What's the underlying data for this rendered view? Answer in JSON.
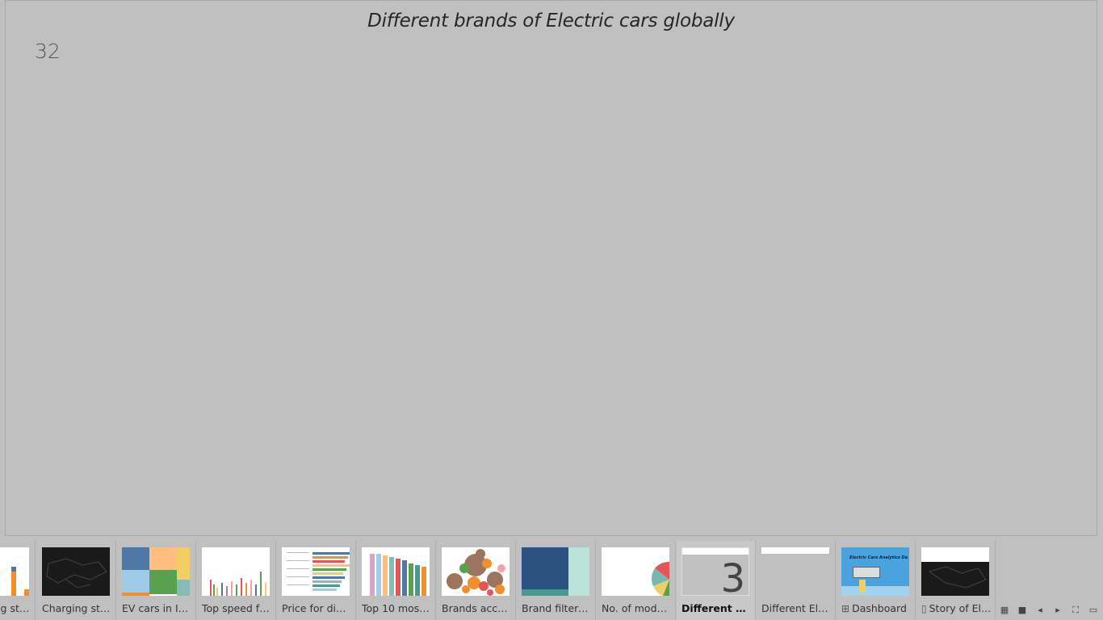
{
  "sheet": {
    "title": "Different brands of Electric cars globally",
    "value": "32"
  },
  "tabs": [
    {
      "label": "Charging stati...",
      "icon": ""
    },
    {
      "label": "Charging stati...",
      "icon": ""
    },
    {
      "label": "EV cars in India",
      "icon": ""
    },
    {
      "label": "Top speed for...",
      "icon": ""
    },
    {
      "label": "Price for diffe...",
      "icon": ""
    },
    {
      "label": "Top 10 most ...",
      "icon": ""
    },
    {
      "label": "Brands accor...",
      "icon": ""
    },
    {
      "label": "Brand filtered...",
      "icon": ""
    },
    {
      "label": "No. of models...",
      "icon": ""
    },
    {
      "label": "Different bra...",
      "icon": "",
      "active": true
    },
    {
      "label": "Different Elec...",
      "icon": ""
    },
    {
      "label": "Dashboard",
      "icon": "dashboard-icon"
    },
    {
      "label": "Story of El...",
      "icon": "story-icon"
    }
  ],
  "thumbs": {
    "dashboard_title": "Electric Cars Analytics Da",
    "big_digit": "3"
  }
}
